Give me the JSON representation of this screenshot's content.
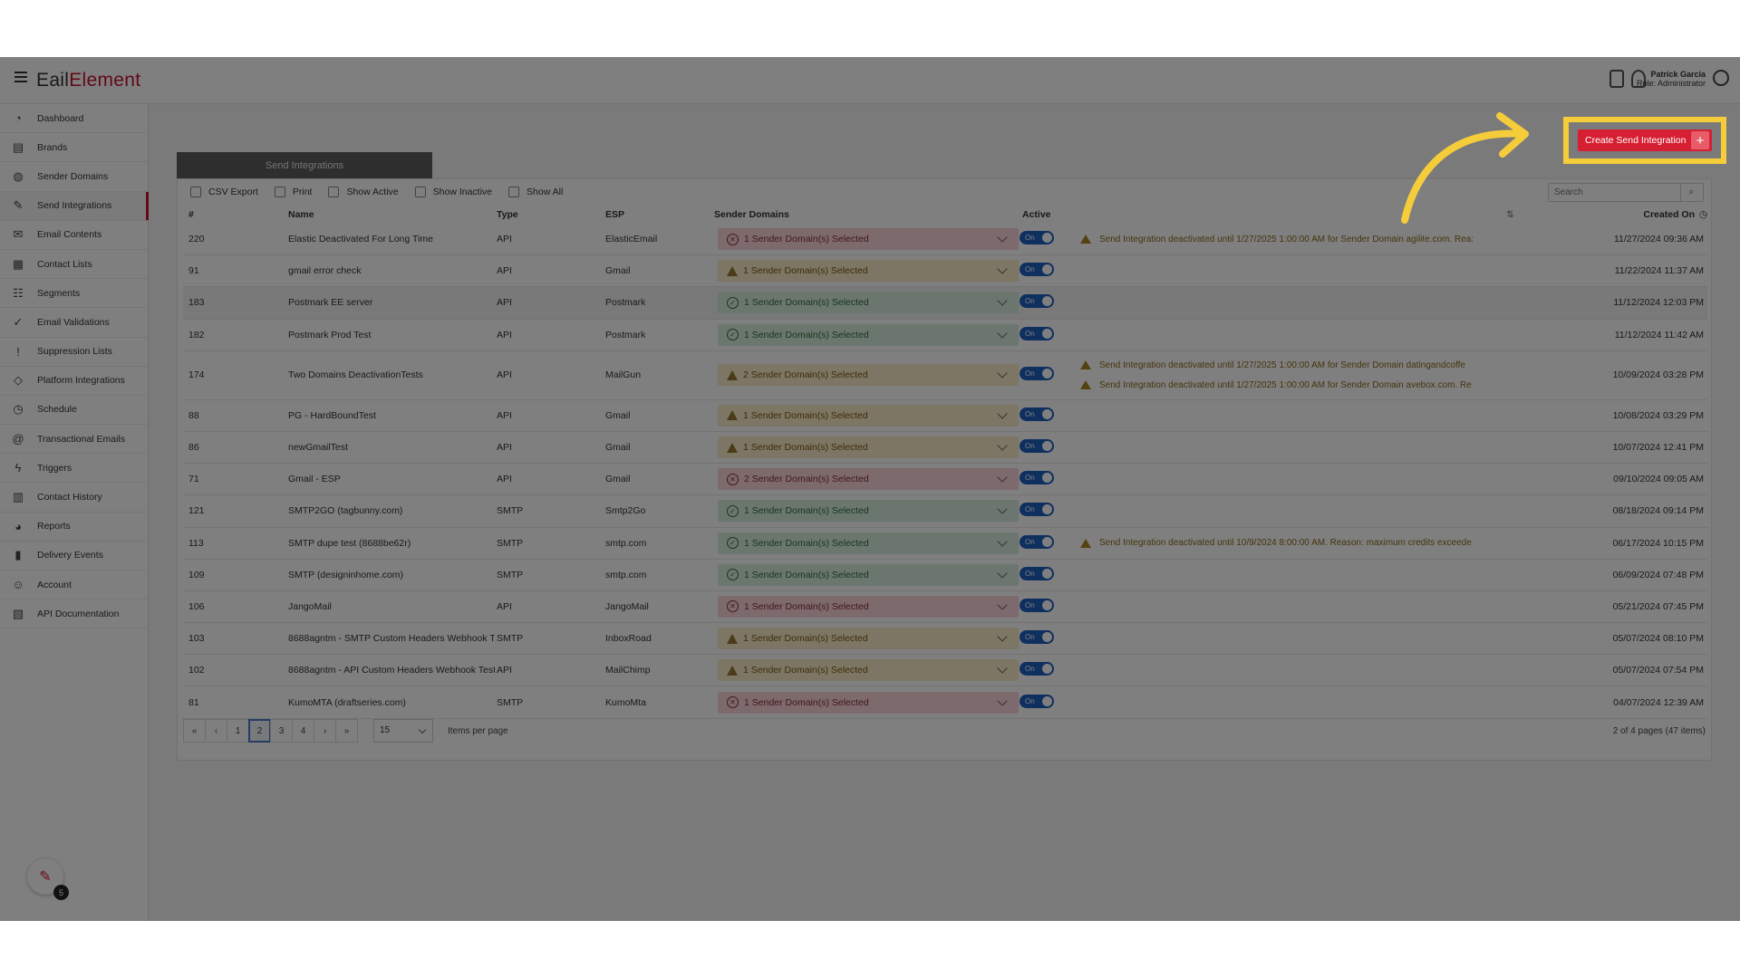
{
  "header": {
    "logo_prefix": "E",
    "logo_mid": "ail",
    "logo_brand": "Element",
    "user_name": "Patrick Garcia",
    "user_role": "Role: Administrator"
  },
  "sidebar": {
    "items": [
      {
        "label": "Dashboard",
        "icon": "dashboard-icon",
        "glyph": "◔"
      },
      {
        "label": "Brands",
        "icon": "brands-icon",
        "glyph": "▤"
      },
      {
        "label": "Sender Domains",
        "icon": "globe-icon",
        "glyph": "◍"
      },
      {
        "label": "Send Integrations",
        "icon": "wrench-icon",
        "glyph": "✎",
        "active": true
      },
      {
        "label": "Email Contents",
        "icon": "envelope-icon",
        "glyph": "✉"
      },
      {
        "label": "Contact Lists",
        "icon": "contact-list-icon",
        "glyph": "▦"
      },
      {
        "label": "Segments",
        "icon": "segments-icon",
        "glyph": "☷"
      },
      {
        "label": "Email Validations",
        "icon": "check-circle-icon",
        "glyph": "✓"
      },
      {
        "label": "Suppression Lists",
        "icon": "alert-circle-icon",
        "glyph": "!"
      },
      {
        "label": "Platform Integrations",
        "icon": "tag-icon",
        "glyph": "◇"
      },
      {
        "label": "Schedule",
        "icon": "clock-icon",
        "glyph": "◷"
      },
      {
        "label": "Transactional Emails",
        "icon": "at-icon",
        "glyph": "@"
      },
      {
        "label": "Triggers",
        "icon": "bolt-icon",
        "glyph": "ϟ"
      },
      {
        "label": "Contact History",
        "icon": "history-icon",
        "glyph": "▥"
      },
      {
        "label": "Reports",
        "icon": "pie-chart-icon",
        "glyph": "◕"
      },
      {
        "label": "Delivery Events",
        "icon": "bar-chart-icon",
        "glyph": "▮"
      },
      {
        "label": "Account",
        "icon": "user-icon",
        "glyph": "☺"
      },
      {
        "label": "API Documentation",
        "icon": "doc-icon",
        "glyph": "▧"
      }
    ]
  },
  "chat_badge": "5",
  "page": {
    "tab_title": "Send Integrations",
    "create_button": "Create Send Integration"
  },
  "toolbar": {
    "csv_export": "CSV Export",
    "print": "Print",
    "show_active": "Show Active",
    "show_inactive": "Show Inactive",
    "show_all": "Show All",
    "search_placeholder": "Search"
  },
  "table": {
    "columns": {
      "id": "#",
      "name": "Name",
      "type": "Type",
      "esp": "ESP",
      "domains": "Sender Domains",
      "active": "Active",
      "created": "Created On"
    },
    "rows": [
      {
        "id": "220",
        "name": "Elastic Deactivated For Long Time",
        "type": "API",
        "esp": "ElasticEmail",
        "domains": "1 Sender Domain(s) Selected",
        "status": "error",
        "active": "On",
        "warnings": [
          "Send Integration deactivated until 1/27/2025 1:00:00 AM for Sender Domain agilite.com. Rea:"
        ],
        "created": "11/27/2024 09:36 AM"
      },
      {
        "id": "91",
        "name": "gmail error check",
        "type": "API",
        "esp": "Gmail",
        "domains": "1 Sender Domain(s) Selected",
        "status": "warning",
        "active": "On",
        "warnings": [],
        "created": "11/22/2024 11:37 AM"
      },
      {
        "id": "183",
        "name": "Postmark EE server",
        "type": "API",
        "esp": "Postmark",
        "domains": "1 Sender Domain(s) Selected",
        "status": "success",
        "active": "On",
        "warnings": [],
        "created": "11/12/2024 12:03 PM",
        "highlight": true
      },
      {
        "id": "182",
        "name": "Postmark Prod Test",
        "type": "API",
        "esp": "Postmark",
        "domains": "1 Sender Domain(s) Selected",
        "status": "success",
        "active": "On",
        "warnings": [],
        "created": "11/12/2024 11:42 AM"
      },
      {
        "id": "174",
        "name": "Two Domains DeactivationTests",
        "type": "API",
        "esp": "MailGun",
        "domains": "2 Sender Domain(s) Selected",
        "status": "warning",
        "active": "On",
        "warnings": [
          "Send Integration deactivated until 1/27/2025 1:00:00 AM for Sender Domain datingandcoffe",
          "Send Integration deactivated until 1/27/2025 1:00:00 AM for Sender Domain avebox.com. Re"
        ],
        "created": "10/09/2024 03:28 PM"
      },
      {
        "id": "88",
        "name": "PG - HardBoundTest",
        "type": "API",
        "esp": "Gmail",
        "domains": "1 Sender Domain(s) Selected",
        "status": "warning",
        "active": "On",
        "warnings": [],
        "created": "10/08/2024 03:29 PM"
      },
      {
        "id": "86",
        "name": "newGmailTest",
        "type": "API",
        "esp": "Gmail",
        "domains": "1 Sender Domain(s) Selected",
        "status": "warning",
        "active": "On",
        "warnings": [],
        "created": "10/07/2024 12:41 PM"
      },
      {
        "id": "71",
        "name": "Gmail - ESP",
        "type": "API",
        "esp": "Gmail",
        "domains": "2 Sender Domain(s) Selected",
        "status": "error",
        "active": "On",
        "warnings": [],
        "created": "09/10/2024 09:05 AM"
      },
      {
        "id": "121",
        "name": "SMTP2GO (tagbunny.com)",
        "type": "SMTP",
        "esp": "Smtp2Go",
        "domains": "1 Sender Domain(s) Selected",
        "status": "success",
        "active": "On",
        "warnings": [],
        "created": "08/18/2024 09:14 PM"
      },
      {
        "id": "113",
        "name": "SMTP dupe test (8688be62r)",
        "type": "SMTP",
        "esp": "smtp.com",
        "domains": "1 Sender Domain(s) Selected",
        "status": "success",
        "active": "On",
        "warnings": [
          "Send Integration deactivated until 10/9/2024 8:00:00 AM. Reason: maximum credits exceede"
        ],
        "created": "06/17/2024 10:15 PM"
      },
      {
        "id": "109",
        "name": "SMTP (designinhome.com)",
        "type": "SMTP",
        "esp": "smtp.com",
        "domains": "1 Sender Domain(s) Selected",
        "status": "success",
        "active": "On",
        "warnings": [],
        "created": "06/09/2024 07:48 PM"
      },
      {
        "id": "106",
        "name": "JangoMail",
        "type": "API",
        "esp": "JangoMail",
        "domains": "1 Sender Domain(s) Selected",
        "status": "error",
        "active": "On",
        "warnings": [],
        "created": "05/21/2024 07:45 PM"
      },
      {
        "id": "103",
        "name": "8688agntm - SMTP Custom Headers Webhook T",
        "type": "SMTP",
        "esp": "InboxRoad",
        "domains": "1 Sender Domain(s) Selected",
        "status": "warning",
        "active": "On",
        "warnings": [],
        "created": "05/07/2024 08:10 PM"
      },
      {
        "id": "102",
        "name": "8688agntm - API Custom Headers Webhook Test",
        "type": "API",
        "esp": "MailChimp",
        "domains": "1 Sender Domain(s) Selected",
        "status": "warning",
        "active": "On",
        "warnings": [],
        "created": "05/07/2024 07:54 PM"
      },
      {
        "id": "81",
        "name": "KumoMTA (draftseries.com)",
        "type": "SMTP",
        "esp": "KumoMta",
        "domains": "1 Sender Domain(s) Selected",
        "status": "error",
        "active": "On",
        "warnings": [],
        "created": "04/07/2024 12:39 AM"
      }
    ]
  },
  "pagination": {
    "first": "«",
    "prev": "‹",
    "pages": [
      "1",
      "2",
      "3",
      "4"
    ],
    "current": "2",
    "next": "›",
    "last": "»",
    "per_page": "15",
    "per_page_label": "Items per page",
    "info": "2 of 4 pages (47 items)"
  },
  "colors": {
    "brand": "#c8102e",
    "highlight": "#f5cd3a",
    "toggle": "#1f5fbf"
  }
}
